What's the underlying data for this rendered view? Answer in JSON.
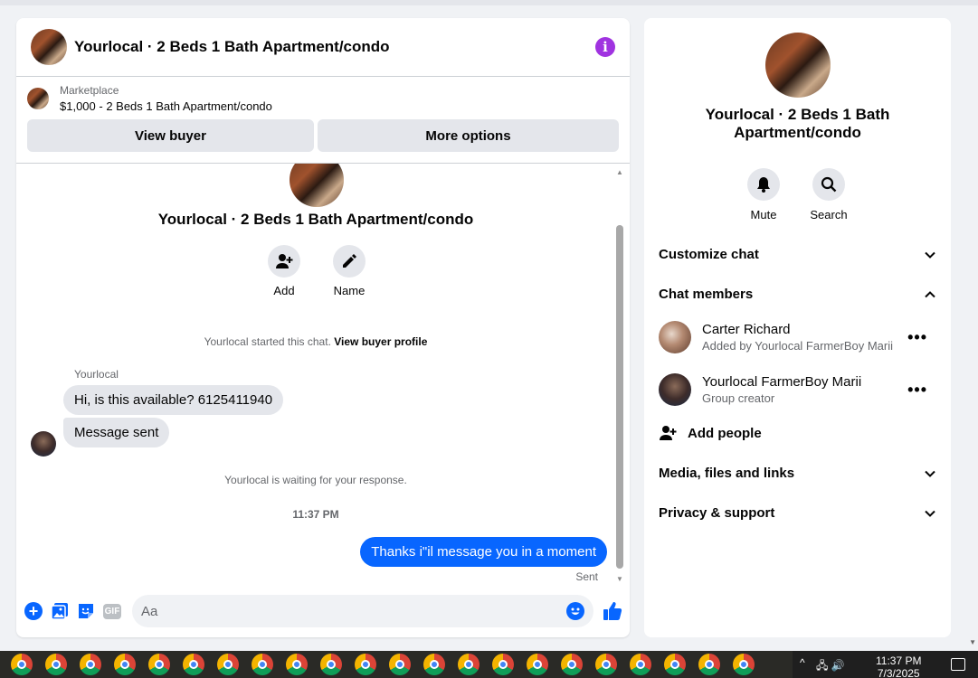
{
  "chat": {
    "title": "Yourlocal · 2 Beds 1 Bath Apartment/condo",
    "listing": {
      "kicker": "Marketplace",
      "line": "$1,000 - 2 Beds 1 Bath Apartment/condo"
    },
    "buttons": {
      "view_buyer": "View buyer",
      "more_options": "More options"
    },
    "thread": {
      "title": "Yourlocal · 2 Beds 1 Bath Apartment/condo",
      "actions": {
        "add": "Add",
        "name": "Name"
      },
      "started_text": "Yourlocal started this chat.",
      "view_buyer_profile": "View buyer profile",
      "sender": "Yourlocal",
      "messages_in": [
        "Hi, is this available? 6125411940",
        "Message sent"
      ],
      "waiting": "Yourlocal is waiting for your response.",
      "time": "11:37 PM",
      "message_out": "Thanks i\"il message you in a moment",
      "sent_status": "Sent"
    },
    "composer": {
      "placeholder": "Aa",
      "gif": "GIF"
    }
  },
  "details": {
    "title": "Yourlocal · 2 Beds 1 Bath Apartment/condo",
    "actions": {
      "mute": "Mute",
      "search": "Search"
    },
    "sections": {
      "customize": "Customize chat",
      "members": "Chat members",
      "media": "Media, files and links",
      "privacy": "Privacy & support"
    },
    "members": [
      {
        "name": "Carter Richard",
        "sub": "Added by Yourlocal FarmerBoy Marii"
      },
      {
        "name": "Yourlocal FarmerBoy Marii",
        "sub": "Group creator"
      }
    ],
    "add_people": "Add people"
  },
  "taskbar": {
    "clock_time": "11:37 PM",
    "clock_date": "7/3/2025"
  },
  "colors": {
    "accent": "#0866ff",
    "info": "#a033e0",
    "bubble_in": "#e4e6eb"
  }
}
